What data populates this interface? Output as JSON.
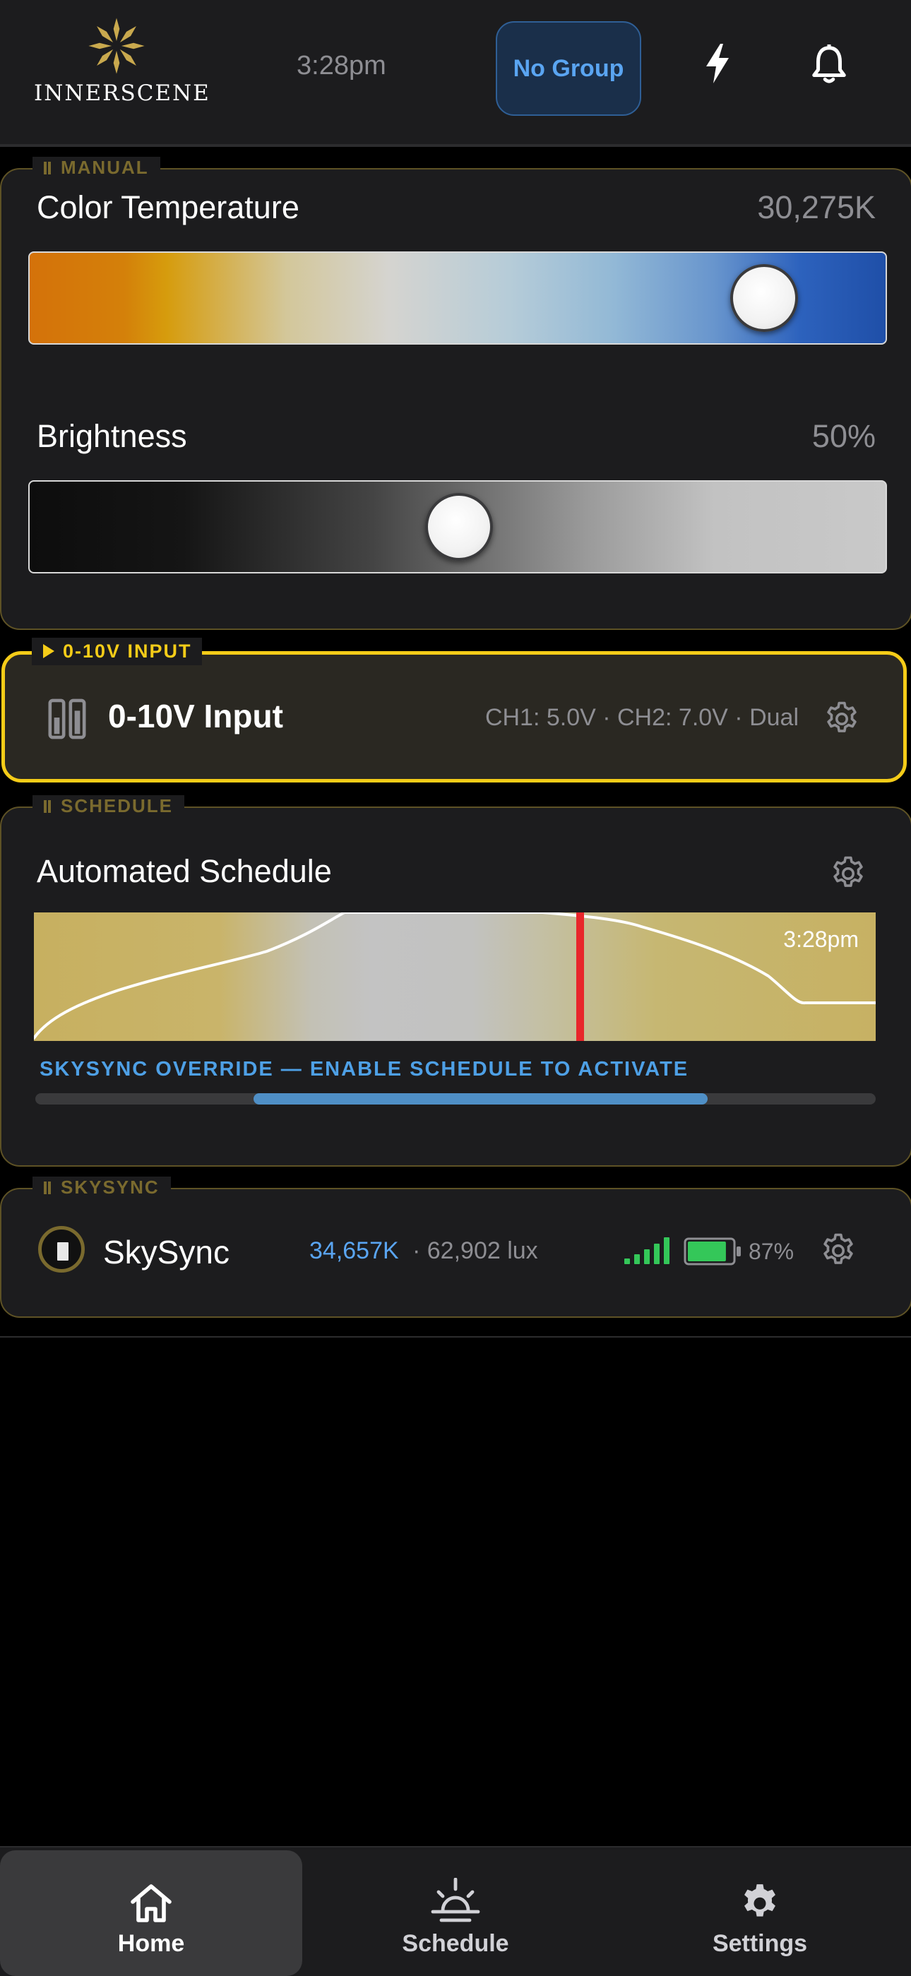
{
  "header": {
    "brand": "INNERSCENE",
    "time": "3:28pm",
    "group_button": "No Group",
    "icons": [
      "lightning-icon",
      "bell-icon"
    ]
  },
  "manual": {
    "tag": "MANUAL",
    "color_temp": {
      "label": "Color Temperature",
      "value": "30,275K",
      "level": 0.855
    },
    "brightness": {
      "label": "Brightness",
      "value": "50%",
      "level": 0.5
    }
  },
  "input": {
    "tag": "0-10V INPUT",
    "title": "0-10V Input",
    "detail": "CH1: 5.0V · CH2: 7.0V · Dual",
    "accent": "#f5cc18"
  },
  "schedule": {
    "tag": "SCHEDULE",
    "title": "Automated Schedule",
    "chart_time": "3:28pm",
    "override": "SKYSYNC OVERRIDE — ENABLE SCHEDULE TO ACTIVATE",
    "progress_start": 0.26,
    "progress_end": 0.8
  },
  "skysync": {
    "tag": "SKYSYNC",
    "name": "SkySync",
    "kelvin": "34,657K",
    "lux": "· 62,902 lux",
    "battery": "87%",
    "battery_level": 0.87,
    "signal_bars": 5
  },
  "nav": {
    "home": "Home",
    "schedule": "Schedule",
    "settings": "Settings"
  },
  "colors": {
    "background": "#1c1c1e",
    "accent_gold": "#c9a94e",
    "accent_blue": "#4ea0e6",
    "signal_green": "#34c759"
  }
}
